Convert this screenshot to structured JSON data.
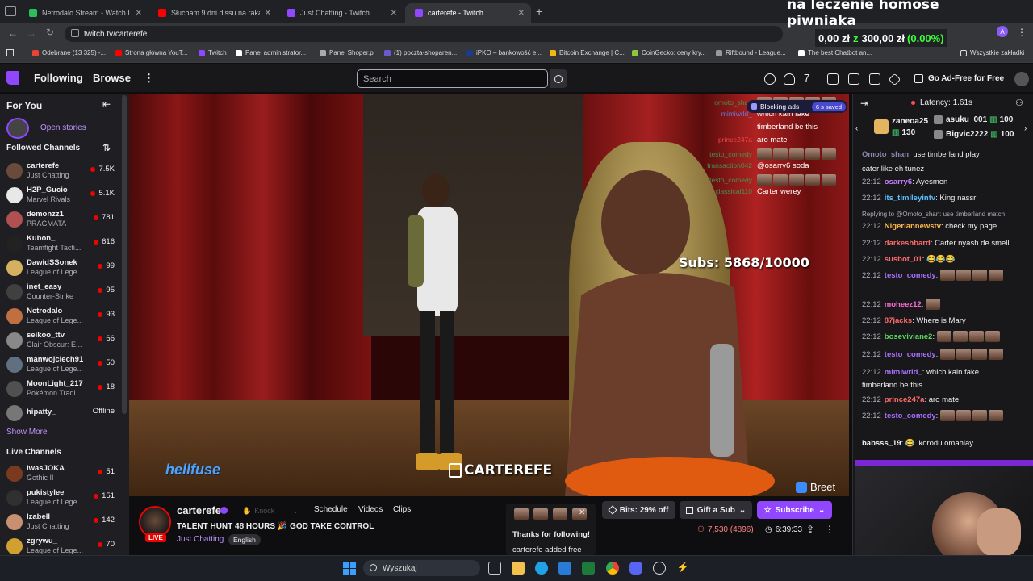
{
  "browser": {
    "tabs": [
      {
        "title": "Netrodalo Stream - Watch L",
        "icon_color": "#2cbc5a"
      },
      {
        "title": "Słucham 9 dni dissu na raka ze",
        "icon_color": "#ff0000"
      },
      {
        "title": "Just Chatting - Twitch",
        "icon_color": "#9146ff"
      },
      {
        "title": "carterefe - Twitch",
        "icon_color": "#9146ff"
      }
    ],
    "url": "twitch.tv/carterefe",
    "bookmarks": [
      {
        "label": "Odebrane (13 325) -...",
        "color": "#ea4335"
      },
      {
        "label": "Strona główna YouT...",
        "color": "#ff0000"
      },
      {
        "label": "Twitch",
        "color": "#9146ff"
      },
      {
        "label": "Panel administrator...",
        "color": "#ffffff"
      },
      {
        "label": "Panel Shoper.pl",
        "color": "#aaaaaa"
      },
      {
        "label": "(1) poczta-shoparen...",
        "color": "#6a5acd"
      },
      {
        "label": "iPKO – bankowość e...",
        "color": "#1a3c8a"
      },
      {
        "label": "Bitcoin Exchange | C...",
        "color": "#f0b90b"
      },
      {
        "label": "CoinGecko: ceny kry...",
        "color": "#8dc63f"
      },
      {
        "label": "Riftbound - League...",
        "color": "#999999"
      },
      {
        "label": "The best Chatbot an...",
        "color": "#ffffff"
      }
    ],
    "all_bookmarks": "Wszystkie zakładki"
  },
  "overlay": {
    "title": "na leczenie homose piwniaka",
    "donation_current": "0,00 zł",
    "donation_sep": "z",
    "donation_goal": "300,00 zł",
    "donation_pct": "(0.00%)"
  },
  "nav": {
    "following": "Following",
    "browse": "Browse",
    "search_placeholder": "Search",
    "ad_free": "Go Ad-Free for Free"
  },
  "sidebar": {
    "for_you": "For You",
    "open_stories": "Open stories",
    "followed_channels": "Followed Channels",
    "show_more": "Show More",
    "live_channels": "Live Channels",
    "followed": [
      {
        "name": "carterefe",
        "game": "Just Chatting",
        "viewers": "7.5K",
        "color": "#6a4a3a"
      },
      {
        "name": "H2P_Gucio",
        "game": "Marvel Rivals",
        "viewers": "5.1K",
        "color": "#e8e8e8"
      },
      {
        "name": "demonzz1",
        "game": "PRAGMATA",
        "viewers": "781",
        "color": "#b05050"
      },
      {
        "name": "Kubon_",
        "game": "Teamfight Tacti...",
        "viewers": "616",
        "color": "#222222"
      },
      {
        "name": "DawidSSonek",
        "game": "League of Lege...",
        "viewers": "99",
        "color": "#d4b060"
      },
      {
        "name": "inet_easy",
        "game": "Counter-Strike",
        "viewers": "95",
        "color": "#404040"
      },
      {
        "name": "Netrodalo",
        "game": "League of Lege...",
        "viewers": "93",
        "color": "#c07040"
      },
      {
        "name": "seikoo_ttv",
        "game": "Clair Obscur: E...",
        "viewers": "66",
        "color": "#888888"
      },
      {
        "name": "manwojciech91",
        "game": "League of Lege...",
        "viewers": "50",
        "color": "#607080"
      },
      {
        "name": "MoonLight_217",
        "game": "Pokémon Tradi...",
        "viewers": "18",
        "color": "#505050"
      },
      {
        "name": "hipatty_",
        "game": "",
        "viewers": "Offline",
        "color": "#777777"
      }
    ],
    "live": [
      {
        "name": "iwasJOKA",
        "game": "Gothic II",
        "viewers": "51",
        "color": "#7a3a20"
      },
      {
        "name": "pukistylee",
        "game": "League of Lege...",
        "viewers": "151",
        "color": "#303030"
      },
      {
        "name": "Izabell",
        "game": "Just Chatting",
        "viewers": "142",
        "color": "#c89070"
      },
      {
        "name": "zgrywu_",
        "game": "League of Lege...",
        "viewers": "70",
        "color": "#d0a030"
      }
    ]
  },
  "video": {
    "subs_counter": "Subs: 5868/10000",
    "watermark_left": "hellfuse",
    "watermark_center": "CARTEREFE",
    "watermark_right": "Breet",
    "block_ads": "Blocking ads",
    "block_saved": "6 s saved",
    "chat_overlay": [
      {
        "user": "omoto_shan",
        "text": "",
        "color": "#3aa757"
      },
      {
        "user": "mimiwrld_",
        "text": "which kain fake",
        "color": "#5b8cff"
      },
      {
        "user": "",
        "text": "timberland be this",
        "color": "#ffffff"
      },
      {
        "user": "prince247a",
        "text": "aro mate",
        "color": "#ff4d4d"
      },
      {
        "user": "testo_comedy",
        "text": "",
        "color": "#3aa757"
      },
      {
        "user": "transaction042",
        "text": "@osarry6 soda",
        "color": "#3aa757"
      },
      {
        "user": "testo_comedy",
        "text": "",
        "color": "#3aa757"
      },
      {
        "user": "classical110",
        "text": "Carter werey",
        "color": "#3aa757"
      }
    ]
  },
  "info": {
    "streamer": "carterefe",
    "live": "LIVE",
    "knock": "Knock",
    "tabs": [
      "Schedule",
      "Videos",
      "Clips"
    ],
    "title": "TALENT HUNT 48 HOURS 🎉 GOD TAKE CONTROL",
    "category": "Just Chatting",
    "tag": "English",
    "bits": "Bits: 29% off",
    "gift": "Gift a Sub",
    "subscribe": "Subscribe",
    "viewers": "7,530 (4896)",
    "uptime": "6:39:33",
    "notif_line1": "Thanks for following!",
    "notif_line2": "carterefe added free"
  },
  "chat": {
    "latency": "Latency: 1.61s",
    "gifters": [
      {
        "name": "zaneoa25",
        "count": "130"
      },
      {
        "name": "asuku_001",
        "count": "100"
      },
      {
        "name": "Bigvic2222",
        "count": "100"
      }
    ],
    "messages": [
      {
        "time": "",
        "user": "Omoto_shan",
        "text": "use timberland play",
        "color": "#8a8ab0"
      },
      {
        "time": "",
        "user": "",
        "text": "cater like eh tunez",
        "color": "#efeff1"
      },
      {
        "time": "22:12",
        "user": "osarry6",
        "text": "Ayesmen",
        "color": "#c77dff"
      },
      {
        "time": "22:12",
        "user": "its_timileyintv",
        "text": "King nassr",
        "color": "#5bc0ff"
      },
      {
        "time": "",
        "user": "",
        "text": "Replying to @Omoto_shan: use timberland match",
        "color": "#adadb8"
      },
      {
        "time": "22:12",
        "user": "Nigeriannewstv",
        "text": "check my page",
        "color": "#ffb84d"
      },
      {
        "time": "22:12",
        "user": "darkeshbard",
        "text": "Carter nyash de smell",
        "color": "#ff6b6b"
      },
      {
        "time": "22:12",
        "user": "susbot_01",
        "text": "😂😂😂",
        "color": "#ff6b6b"
      },
      {
        "time": "22:12",
        "user": "testo_comedy",
        "text": "",
        "color": "#a970ff"
      },
      {
        "time": "22:12",
        "user": "moheez12",
        "text": "",
        "color": "#ff6bd6"
      },
      {
        "time": "22:12",
        "user": "87jacks",
        "text": "Where is Mary",
        "color": "#ff6b6b"
      },
      {
        "time": "22:12",
        "user": "boseviviane2",
        "text": "",
        "color": "#5bd65b"
      },
      {
        "time": "22:12",
        "user": "testo_comedy",
        "text": "",
        "color": "#a970ff"
      },
      {
        "time": "22:12",
        "user": "mimiwrld_",
        "text": "which kain fake",
        "color": "#a970ff"
      },
      {
        "time": "",
        "user": "",
        "text": "timberland be this",
        "color": "#efeff1"
      },
      {
        "time": "22:12",
        "user": "prince247a",
        "text": "aro mate",
        "color": "#ff6b6b"
      },
      {
        "time": "22:12",
        "user": "testo_comedy",
        "text": "",
        "color": "#a970ff"
      },
      {
        "time": "",
        "user": "babsss_19",
        "text": "😂 ikorodu omahlay",
        "color": "#efeff1"
      }
    ]
  },
  "taskbar": {
    "search": "Wyszukaj"
  }
}
